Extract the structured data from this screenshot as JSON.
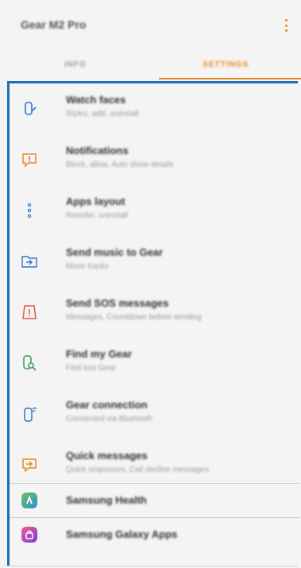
{
  "header": {
    "title": "Gear M2 Pro",
    "menu_icon": "more-vert-icon"
  },
  "tabs": [
    {
      "label": "INFO",
      "active": false
    },
    {
      "label": "SETTINGS",
      "active": true
    }
  ],
  "colors": {
    "accent": "#e88a1f",
    "blue_icon": "#2f78c4",
    "red_icon": "#e05a4b",
    "green_icon": "#3b9a57",
    "selection_border": "#1a6fb5"
  },
  "settings": [
    {
      "icon": "watch-faces-icon",
      "title": "Watch faces",
      "subtitle": "Styles, add, uninstall"
    },
    {
      "icon": "notifications-icon",
      "title": "Notifications",
      "subtitle": "Block, allow, Auto show details"
    },
    {
      "icon": "apps-layout-icon",
      "title": "Apps layout",
      "subtitle": "Reorder, uninstall"
    },
    {
      "icon": "send-music-icon",
      "title": "Send music to Gear",
      "subtitle": "Move tracks"
    },
    {
      "icon": "sos-icon",
      "title": "Send SOS messages",
      "subtitle": "Messages, Countdown before sending"
    },
    {
      "icon": "find-gear-icon",
      "title": "Find my Gear",
      "subtitle": "Find lost Gear"
    },
    {
      "icon": "gear-connection-icon",
      "title": "Gear connection",
      "subtitle": "Connected via Bluetooth"
    },
    {
      "icon": "quick-messages-icon",
      "title": "Quick messages",
      "subtitle": "Quick responses, Call decline messages"
    }
  ],
  "apps": [
    {
      "icon": "samsung-health-icon",
      "title": "Samsung Health"
    },
    {
      "icon": "galaxy-apps-icon",
      "title": "Samsung Galaxy Apps"
    }
  ]
}
